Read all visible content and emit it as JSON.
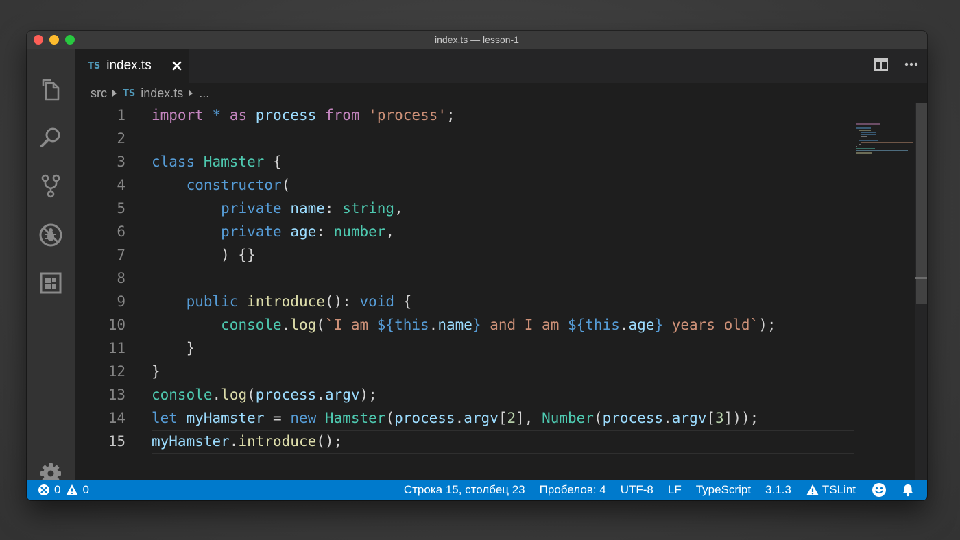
{
  "window": {
    "title": "index.ts — lesson-1"
  },
  "tabs": [
    {
      "badge": "TS",
      "label": "index.ts"
    }
  ],
  "breadcrumb": {
    "folder": "src",
    "file_badge": "TS",
    "file": "index.ts",
    "more": "..."
  },
  "activity_bar": [
    "files-icon",
    "search-icon",
    "source-control-icon",
    "debug-icon",
    "extensions-icon",
    "gear-icon"
  ],
  "editor": {
    "active_line": 15,
    "lines": [
      {
        "num": "1",
        "text": "import * as process from 'process';"
      },
      {
        "num": "2",
        "text": ""
      },
      {
        "num": "3",
        "text": "class Hamster {"
      },
      {
        "num": "4",
        "text": "    constructor("
      },
      {
        "num": "5",
        "text": "        private name: string,"
      },
      {
        "num": "6",
        "text": "        private age: number,"
      },
      {
        "num": "7",
        "text": "        ) {}"
      },
      {
        "num": "8",
        "text": ""
      },
      {
        "num": "9",
        "text": "    public introduce(): void {"
      },
      {
        "num": "10",
        "text": "        console.log(`I am ${this.name} and I am ${this.age} years old`);"
      },
      {
        "num": "11",
        "text": "    }"
      },
      {
        "num": "12",
        "text": "}"
      },
      {
        "num": "13",
        "text": "console.log(process.argv);"
      },
      {
        "num": "14",
        "text": "let myHamster = new Hamster(process.argv[2], Number(process.argv[3]));"
      },
      {
        "num": "15",
        "text": "myHamster.introduce();"
      }
    ]
  },
  "statusbar": {
    "errors": "0",
    "warnings": "0",
    "position": "Строка 15, столбец 23",
    "spaces": "Пробелов: 4",
    "encoding": "UTF-8",
    "eol": "LF",
    "language": "TypeScript",
    "version": "3.1.3",
    "linter": "TSLint"
  },
  "colors": {
    "statusbar": "#007acc",
    "keyword": "#c586c0",
    "storage": "#569cd6",
    "type": "#4ec9b0",
    "function": "#dcdcaa",
    "variable": "#9cdcfe",
    "string": "#ce9178",
    "number": "#b5cea8"
  }
}
